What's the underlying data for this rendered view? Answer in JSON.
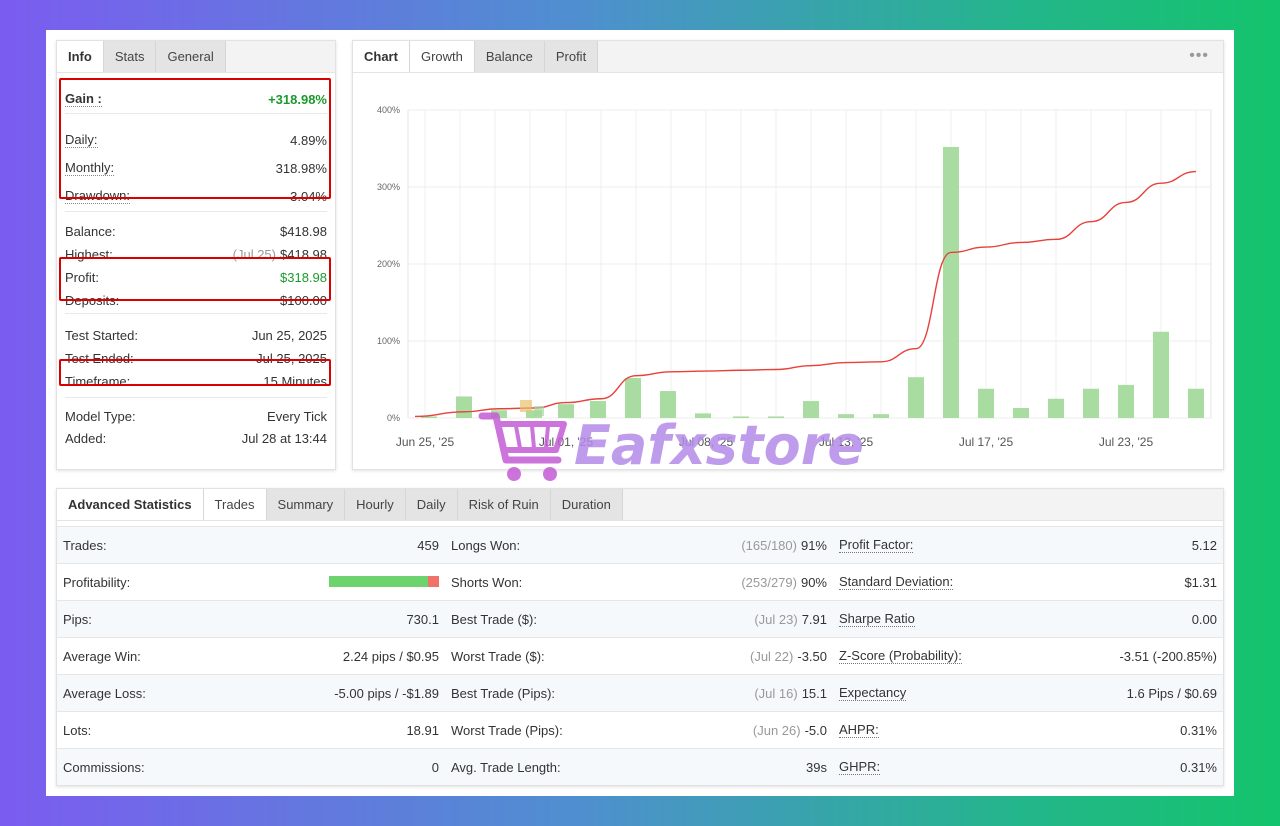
{
  "info_panel": {
    "tabs": [
      "Info",
      "Stats",
      "General"
    ],
    "rows": [
      {
        "label": "Gain :",
        "value": "+318.98%",
        "hint": "",
        "green": true,
        "bold": true,
        "dotted": true
      },
      {
        "label": "Daily:",
        "value": "4.89%",
        "hint": "",
        "green": false,
        "bold": false,
        "dotted": true
      },
      {
        "label": "Monthly:",
        "value": "318.98%",
        "hint": "",
        "green": false,
        "bold": false,
        "dotted": true
      },
      {
        "label": "Drawdown:",
        "value": "3.04%",
        "hint": "",
        "green": false,
        "bold": false,
        "dotted": true
      },
      {
        "label": "Balance:",
        "value": "$418.98",
        "hint": "",
        "green": false,
        "bold": false,
        "dotted": false
      },
      {
        "label": "Highest:",
        "value": "$418.98",
        "hint": "(Jul 25)",
        "green": false,
        "bold": false,
        "dotted": false
      },
      {
        "label": "Profit:",
        "value": "$318.98",
        "hint": "",
        "green": true,
        "bold": false,
        "dotted": false
      },
      {
        "label": "Deposits:",
        "value": "$100.00",
        "hint": "",
        "green": false,
        "bold": false,
        "dotted": false
      },
      {
        "label": "Test Started:",
        "value": "Jun 25, 2025",
        "hint": "",
        "green": false,
        "bold": false,
        "dotted": false
      },
      {
        "label": "Test Ended:",
        "value": "Jul 25, 2025",
        "hint": "",
        "green": false,
        "bold": false,
        "dotted": false
      },
      {
        "label": "Timeframe:",
        "value": "15 Minutes",
        "hint": "",
        "green": false,
        "bold": false,
        "dotted": false
      },
      {
        "label": "Model Type:",
        "value": "Every Tick",
        "hint": "",
        "green": false,
        "bold": false,
        "dotted": false
      },
      {
        "label": "Added:",
        "value": "Jul 28 at 13:44",
        "hint": "",
        "green": false,
        "bold": false,
        "dotted": false
      }
    ]
  },
  "chart_panel": {
    "tabs": [
      "Chart",
      "Growth",
      "Balance",
      "Profit"
    ],
    "active_tab": "Growth",
    "menu_icon": "more-dots-icon"
  },
  "chart_data": {
    "type": "bar",
    "ylim": [
      0,
      400
    ],
    "yticks": [
      "0%",
      "100%",
      "200%",
      "300%",
      "400%"
    ],
    "xticks": [
      "Jun 25, '25",
      "Jul 01, '25",
      "Jul 08, '25",
      "Jul 13, '25",
      "Jul 17, '25",
      "Jul 23, '25"
    ],
    "bar_color": "#a8dca0",
    "line_color": "#e8403a",
    "grid": true,
    "series": [
      {
        "type": "bar",
        "x": [
          "Jun 25",
          "Jun 26",
          "Jun 27",
          "Jun 30",
          "Jul 01",
          "Jul 02",
          "Jul 03",
          "Jul 04",
          "Jul 07",
          "Jul 08",
          "Jul 09",
          "Jul 10",
          "Jul 11",
          "Jul 14",
          "Jul 15",
          "Jul 16",
          "Jul 17",
          "Jul 18",
          "Jul 21",
          "Jul 22",
          "Jul 23",
          "Jul 24",
          "Jul 25"
        ],
        "values": [
          2,
          28,
          10,
          10,
          18,
          22,
          52,
          35,
          6,
          2,
          2,
          22,
          5,
          5,
          53,
          352,
          38,
          13,
          25,
          38,
          43,
          112,
          38
        ]
      },
      {
        "type": "line",
        "x": [
          "Jun 25",
          "Jun 26",
          "Jun 27",
          "Jun 30",
          "Jul 01",
          "Jul 02",
          "Jul 03",
          "Jul 04",
          "Jul 07",
          "Jul 08",
          "Jul 09",
          "Jul 10",
          "Jul 11",
          "Jul 14",
          "Jul 15",
          "Jul 16",
          "Jul 17",
          "Jul 18",
          "Jul 21",
          "Jul 22",
          "Jul 23",
          "Jul 24",
          "Jul 25"
        ],
        "values": [
          2,
          8,
          12,
          13,
          20,
          25,
          55,
          60,
          61,
          62,
          63,
          68,
          72,
          73,
          90,
          215,
          222,
          228,
          232,
          255,
          280,
          305,
          320
        ]
      }
    ]
  },
  "stats_panel": {
    "tabs": [
      "Advanced Statistics",
      "Trades",
      "Summary",
      "Hourly",
      "Daily",
      "Risk of Ruin",
      "Duration"
    ],
    "active_tab": "Trades",
    "rows": [
      [
        {
          "label": "Trades:",
          "value": "459",
          "hint": "",
          "dotted": false
        },
        {
          "label": "Longs Won:",
          "value": "91%",
          "hint": "(165/180)",
          "dotted": false
        },
        {
          "label": "Profit Factor:",
          "value": "5.12",
          "hint": "",
          "dotted": true
        }
      ],
      [
        {
          "label": "Profitability:",
          "value": "",
          "hint": "",
          "dotted": false,
          "bar": {
            "win_fraction": 0.9,
            "win_color": "#6dd46d",
            "loss_color": "#f0706a"
          }
        },
        {
          "label": "Shorts Won:",
          "value": "90%",
          "hint": "(253/279)",
          "dotted": false
        },
        {
          "label": "Standard Deviation:",
          "value": "$1.31",
          "hint": "",
          "dotted": true
        }
      ],
      [
        {
          "label": "Pips:",
          "value": "730.1",
          "hint": "",
          "dotted": false
        },
        {
          "label": "Best Trade ($):",
          "value": "7.91",
          "hint": "(Jul 23)",
          "dotted": false
        },
        {
          "label": "Sharpe Ratio",
          "value": "0.00",
          "hint": "",
          "dotted": true
        }
      ],
      [
        {
          "label": "Average Win:",
          "value": "2.24 pips / $0.95",
          "hint": "",
          "dotted": false
        },
        {
          "label": "Worst Trade ($):",
          "value": "-3.50",
          "hint": "(Jul 22)",
          "dotted": false
        },
        {
          "label": "Z-Score (Probability):",
          "value": "-3.51 (-200.85%)",
          "hint": "",
          "dotted": true
        }
      ],
      [
        {
          "label": "Average Loss:",
          "value": "-5.00 pips / -$1.89",
          "hint": "",
          "dotted": false
        },
        {
          "label": "Best Trade (Pips):",
          "value": "15.1",
          "hint": "(Jul 16)",
          "dotted": false
        },
        {
          "label": "Expectancy",
          "value": "1.6 Pips / $0.69",
          "hint": "",
          "dotted": true
        }
      ],
      [
        {
          "label": "Lots:",
          "value": "18.91",
          "hint": "",
          "dotted": false
        },
        {
          "label": "Worst Trade (Pips):",
          "value": "-5.0",
          "hint": "(Jun 26)",
          "dotted": false
        },
        {
          "label": "AHPR:",
          "value": "0.31%",
          "hint": "",
          "dotted": true
        }
      ],
      [
        {
          "label": "Commissions:",
          "value": "0",
          "hint": "",
          "dotted": false
        },
        {
          "label": "Avg. Trade Length:",
          "value": "39s",
          "hint": "",
          "dotted": false
        },
        {
          "label": "GHPR:",
          "value": "0.31%",
          "hint": "",
          "dotted": true
        }
      ]
    ]
  },
  "watermark": {
    "text": "Eafxstore",
    "icon": "shopping-cart-icon"
  }
}
